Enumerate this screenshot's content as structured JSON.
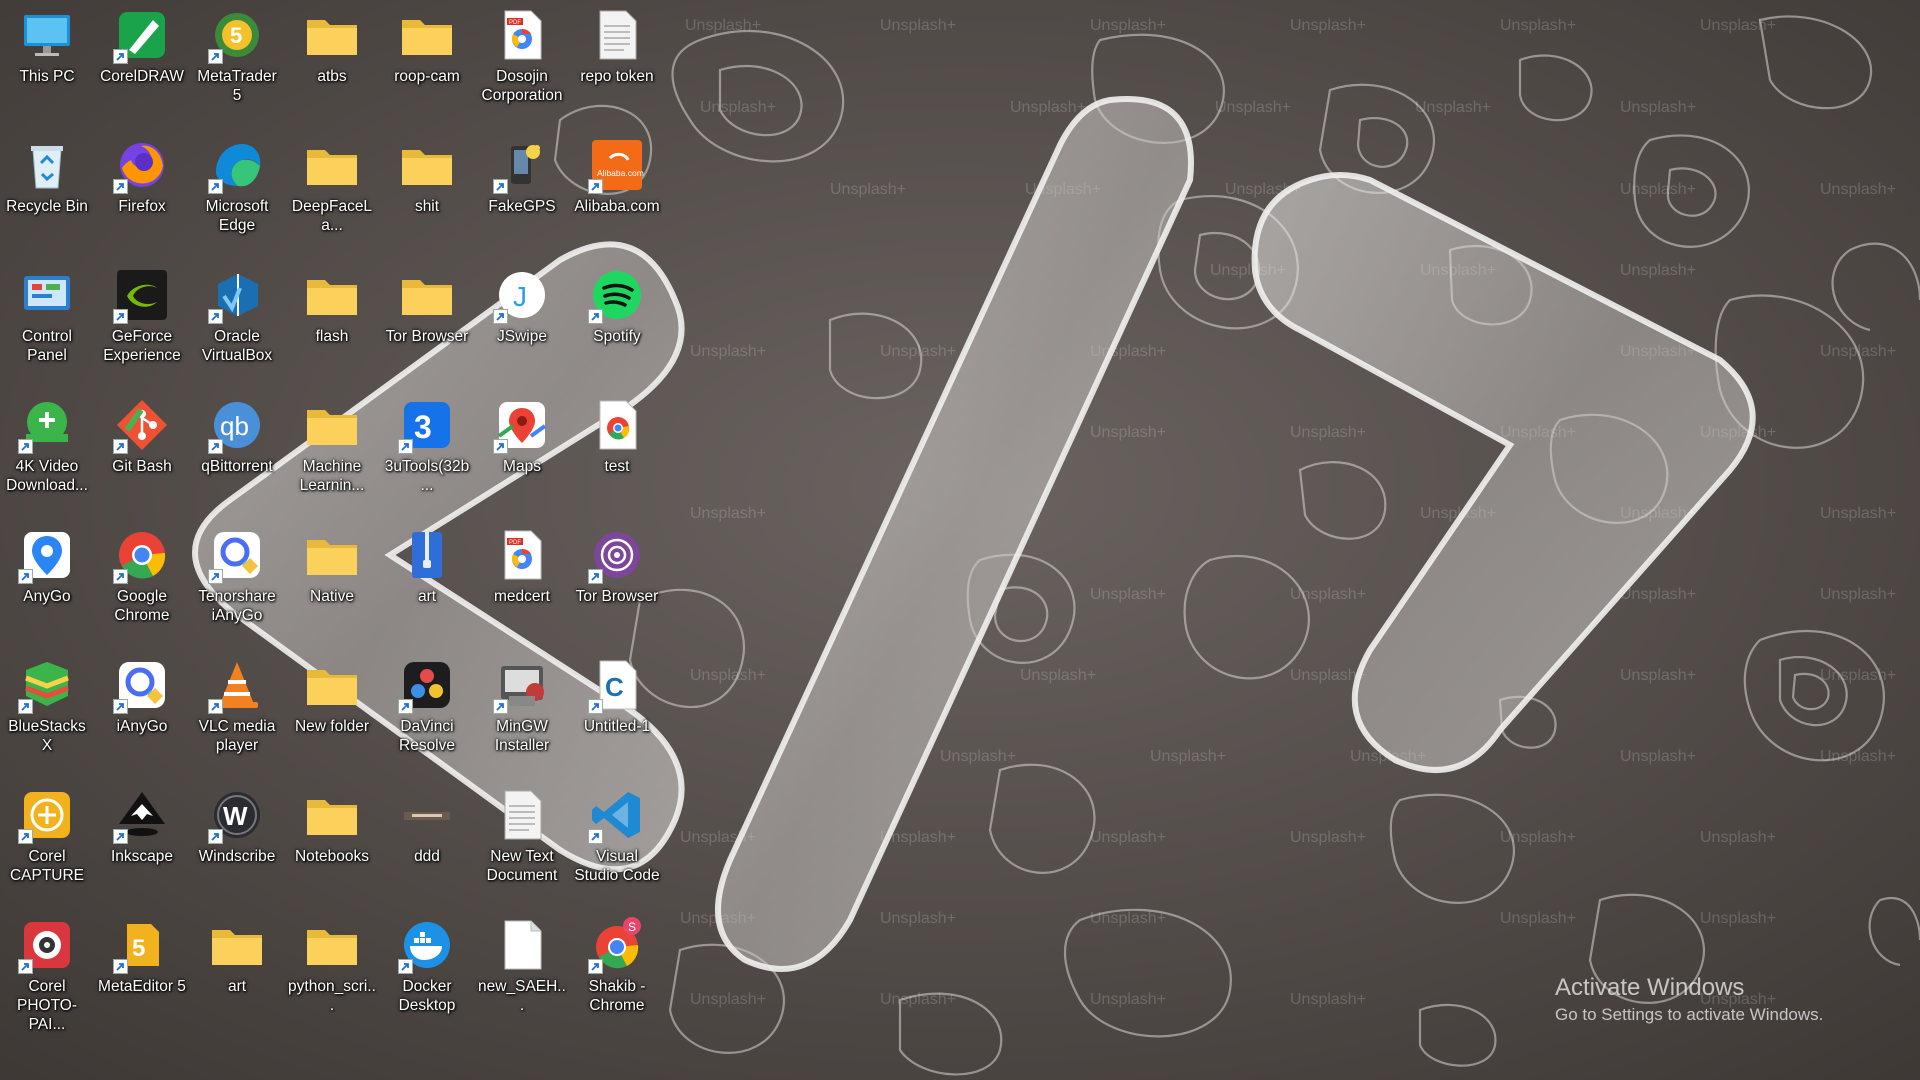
{
  "desktop": {
    "icons": [
      {
        "label": "This PC",
        "icon": "monitor-icon",
        "shortcut": false
      },
      {
        "label": "CorelDRAW",
        "icon": "coreldraw-icon",
        "shortcut": true
      },
      {
        "label": "MetaTrader 5",
        "icon": "metatrader-icon",
        "shortcut": true
      },
      {
        "label": "atbs",
        "icon": "folder-icon",
        "shortcut": false
      },
      {
        "label": "roop-cam",
        "icon": "folder-icon",
        "shortcut": false
      },
      {
        "label": "Dosojin Corporation",
        "icon": "pdf-file-icon",
        "shortcut": false
      },
      {
        "label": "repo token",
        "icon": "text-file-icon",
        "shortcut": false
      },
      {
        "label": "Recycle Bin",
        "icon": "recycle-bin-icon",
        "shortcut": false
      },
      {
        "label": "Firefox",
        "icon": "firefox-icon",
        "shortcut": true
      },
      {
        "label": "Microsoft Edge",
        "icon": "edge-icon",
        "shortcut": true
      },
      {
        "label": "DeepFaceLa...",
        "icon": "folder-icon",
        "shortcut": false
      },
      {
        "label": "shit",
        "icon": "folder-icon",
        "shortcut": false
      },
      {
        "label": "FakeGPS",
        "icon": "fakegps-icon",
        "shortcut": true
      },
      {
        "label": "Alibaba.com",
        "icon": "alibaba-icon",
        "shortcut": true
      },
      {
        "label": "Control Panel",
        "icon": "control-panel-icon",
        "shortcut": false
      },
      {
        "label": "GeForce Experience",
        "icon": "nvidia-icon",
        "shortcut": true
      },
      {
        "label": "Oracle VirtualBox",
        "icon": "virtualbox-icon",
        "shortcut": true
      },
      {
        "label": "flash",
        "icon": "folder-icon",
        "shortcut": false
      },
      {
        "label": "Tor Browser",
        "icon": "folder-icon",
        "shortcut": false
      },
      {
        "label": "JSwipe",
        "icon": "jswipe-icon",
        "shortcut": true
      },
      {
        "label": "Spotify",
        "icon": "spotify-icon",
        "shortcut": true
      },
      {
        "label": "4K Video Download...",
        "icon": "4k-video-icon",
        "shortcut": true
      },
      {
        "label": "Git Bash",
        "icon": "git-icon",
        "shortcut": true
      },
      {
        "label": "qBittorrent",
        "icon": "qbittorrent-icon",
        "shortcut": true
      },
      {
        "label": "Machine Learnin...",
        "icon": "folder-icon",
        "shortcut": false
      },
      {
        "label": "3uTools(32b...",
        "icon": "3utools-icon",
        "shortcut": true
      },
      {
        "label": "Maps",
        "icon": "maps-icon",
        "shortcut": true
      },
      {
        "label": "test",
        "icon": "chrome-file-icon",
        "shortcut": false
      },
      {
        "label": "AnyGo",
        "icon": "anygo-icon",
        "shortcut": true
      },
      {
        "label": "Google Chrome",
        "icon": "chrome-icon",
        "shortcut": true
      },
      {
        "label": "Tenorshare iAnyGo",
        "icon": "ianygo-icon",
        "shortcut": true
      },
      {
        "label": "Native",
        "icon": "folder-icon",
        "shortcut": false
      },
      {
        "label": "art",
        "icon": "zip-icon",
        "shortcut": false
      },
      {
        "label": "medcert",
        "icon": "pdf-file-icon",
        "shortcut": false
      },
      {
        "label": "Tor Browser",
        "icon": "tor-icon",
        "shortcut": true
      },
      {
        "label": "BlueStacks X",
        "icon": "bluestacks-icon",
        "shortcut": true
      },
      {
        "label": "iAnyGo",
        "icon": "ianygo-icon",
        "shortcut": true
      },
      {
        "label": "VLC media player",
        "icon": "vlc-icon",
        "shortcut": true
      },
      {
        "label": "New folder",
        "icon": "folder-icon",
        "shortcut": false
      },
      {
        "label": "DaVinci Resolve",
        "icon": "davinci-icon",
        "shortcut": true
      },
      {
        "label": "MinGW Installer",
        "icon": "mingw-icon",
        "shortcut": true
      },
      {
        "label": "Untitled-1",
        "icon": "c-file-icon",
        "shortcut": true
      },
      {
        "label": "Corel CAPTURE",
        "icon": "corel-capture-icon",
        "shortcut": true
      },
      {
        "label": "Inkscape",
        "icon": "inkscape-icon",
        "shortcut": true
      },
      {
        "label": "Windscribe",
        "icon": "windscribe-icon",
        "shortcut": true
      },
      {
        "label": "Notebooks",
        "icon": "folder-icon",
        "shortcut": false
      },
      {
        "label": "ddd",
        "icon": "image-file-icon",
        "shortcut": false
      },
      {
        "label": "New Text Document",
        "icon": "text-file-icon",
        "shortcut": false
      },
      {
        "label": "Visual Studio Code",
        "icon": "vscode-icon",
        "shortcut": true
      },
      {
        "label": "Corel PHOTO-PAI...",
        "icon": "corel-photopaint-icon",
        "shortcut": true
      },
      {
        "label": "MetaEditor 5",
        "icon": "metaeditor-icon",
        "shortcut": true
      },
      {
        "label": "art",
        "icon": "folder-icon",
        "shortcut": false
      },
      {
        "label": "python_scri...",
        "icon": "folder-icon",
        "shortcut": false
      },
      {
        "label": "Docker Desktop",
        "icon": "docker-icon",
        "shortcut": true
      },
      {
        "label": "new_SAEH...",
        "icon": "blank-file-icon",
        "shortcut": false
      },
      {
        "label": "Shakib - Chrome",
        "icon": "chrome-profile-icon",
        "shortcut": true
      }
    ]
  },
  "wallpaper": {
    "watermark": "Unsplash+",
    "colors": {
      "base": "#5d5652",
      "contour": "#d9d6d3",
      "glass": "#e4e2e0"
    }
  },
  "activation": {
    "title": "Activate Windows",
    "subtitle": "Go to Settings to activate Windows."
  }
}
